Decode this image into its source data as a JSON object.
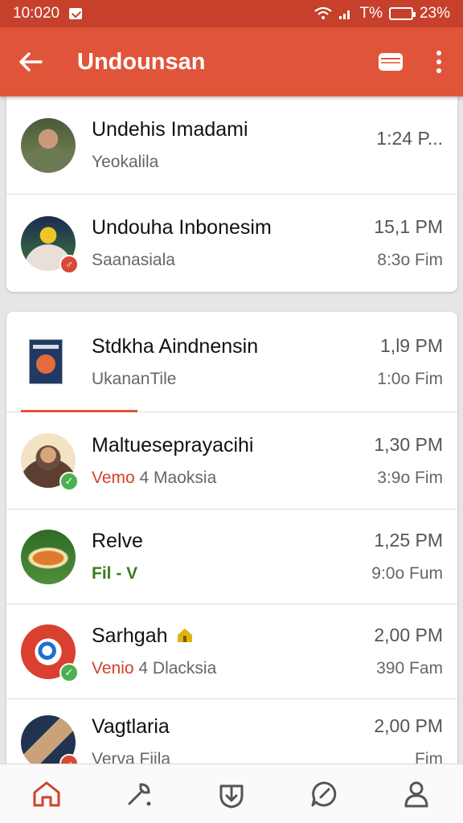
{
  "status_bar": {
    "time": "10:020",
    "network": "T%",
    "battery": "23%"
  },
  "app_bar": {
    "title": "Undounsan",
    "back_icon": "arrow-left-icon",
    "action_icon": "inbox-icon",
    "menu_icon": "more-vert-icon"
  },
  "colors": {
    "primary": "#e0553a",
    "status_bar": "#c6402c",
    "accent_red": "#d5402b",
    "accent_green": "#3a7d1e",
    "badge_green": "#4caf50"
  },
  "card1": {
    "rows": [
      {
        "name": "Undehis Imadami",
        "sub": "Yeokalila",
        "time": "1:24 P...",
        "time2": ""
      },
      {
        "name": "Undouha Inbonesim",
        "sub": "Saanasiala",
        "time": "15,1 PM",
        "time2": "8:3o Fim"
      }
    ]
  },
  "card2": {
    "rows": [
      {
        "name": "Stdkha Aindnensin",
        "sub": "UkananTile",
        "time": "1,l9 PM",
        "time2": "1:0o Fim"
      },
      {
        "name": "Maltueseprayacihi",
        "sub_accent": "Vemo",
        "sub": "4 Maoksia",
        "time": "1,30 PM",
        "time2": "3:9o Fim"
      },
      {
        "name": "Relve",
        "sub_accent": "Fil - V",
        "sub": "",
        "time": "1,25 PM",
        "time2": "9:0o Fum"
      },
      {
        "name": "Sarhgah",
        "sub_accent": "Venio",
        "sub": "4 Dlacksia",
        "time": "2,00 PM",
        "time2": "390 Fam"
      },
      {
        "name": "Vagtlaria",
        "sub": "Verva Fiila",
        "time": "2,00 PM",
        "time2": "Fim"
      }
    ]
  },
  "bottom_nav": {
    "items": [
      {
        "icon": "home-icon"
      },
      {
        "icon": "tools-icon"
      },
      {
        "icon": "download-icon"
      },
      {
        "icon": "chat-icon"
      },
      {
        "icon": "profile-icon"
      }
    ]
  }
}
